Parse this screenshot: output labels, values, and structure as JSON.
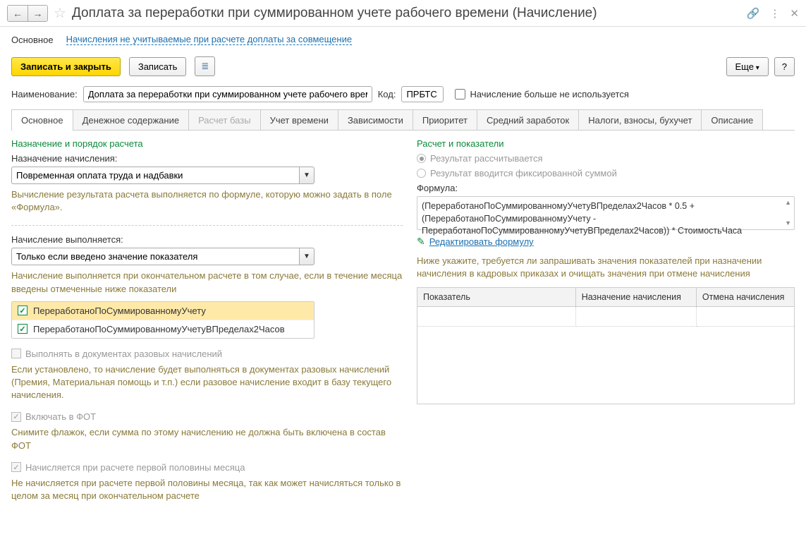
{
  "title": "Доплата за переработки при суммированном учете рабочего времени (Начисление)",
  "linkbar": {
    "main": "Основное",
    "link": "Начисления не учитываемые при расчете доплаты за совмещение"
  },
  "toolbar": {
    "save_close": "Записать и закрыть",
    "save": "Записать",
    "more": "Еще",
    "help": "?"
  },
  "fields": {
    "name_lbl": "Наименование:",
    "name_val": "Доплата за переработки при суммированном учете рабочего време",
    "code_lbl": "Код:",
    "code_val": "ПРБТС",
    "unused_lbl": "Начисление больше не используется"
  },
  "tabs": [
    "Основное",
    "Денежное содержание",
    "Расчет базы",
    "Учет времени",
    "Зависимости",
    "Приоритет",
    "Средний заработок",
    "Налоги, взносы, бухучет",
    "Описание"
  ],
  "left": {
    "sect1": "Назначение и порядок расчета",
    "purpose_lbl": "Назначение начисления:",
    "purpose_val": "Повременная оплата труда и надбавки",
    "purpose_help": "Вычисление результата расчета выполняется по формуле, которую можно задать в поле «Формула».",
    "exec_lbl": "Начисление выполняется:",
    "exec_val": "Только если введено значение показателя",
    "exec_help": "Начисление выполняется при окончательном расчете в том случае, если в течение месяца введены отмеченные ниже показатели",
    "ind1": "ПереработаноПоСуммированномуУчету",
    "ind2": "ПереработаноПоСуммированномуУчетуВПределах2Часов",
    "onetime_lbl": "Выполнять в документах разовых начислений",
    "onetime_help": "Если установлено, то начисление будет выполняться в документах разовых начислений (Премия, Материальная помощь и т.п.) если разовое начисление входит в базу текущего начисления.",
    "fot_lbl": "Включать в ФОТ",
    "fot_help": "Снимите флажок, если сумма по этому начислению не должна быть включена в состав ФОТ",
    "half_lbl": "Начисляется при расчете первой половины месяца",
    "half_help": "Не начисляется при расчете первой половины месяца, так как может начисляться только в целом за месяц при окончательном расчете"
  },
  "right": {
    "sect": "Расчет и показатели",
    "r1": "Результат рассчитывается",
    "r2": "Результат вводится фиксированной суммой",
    "formula_lbl": "Формула:",
    "formula": "(ПереработаноПоСуммированномуУчетуВПределах2Часов * 0.5 + (ПереработаноПоСуммированномуУчету - ПереработаноПоСуммированномуУчетуВПределах2Часов)) * СтоимостьЧаса",
    "edit": "Редактировать формулу",
    "ind_help": "Ниже укажите, требуется ли запрашивать значения показателей при назначении начисления в кадровых приказах и очищать значения при отмене начисления",
    "th1": "Показатель",
    "th2": "Назначение начисления",
    "th3": "Отмена начисления"
  }
}
